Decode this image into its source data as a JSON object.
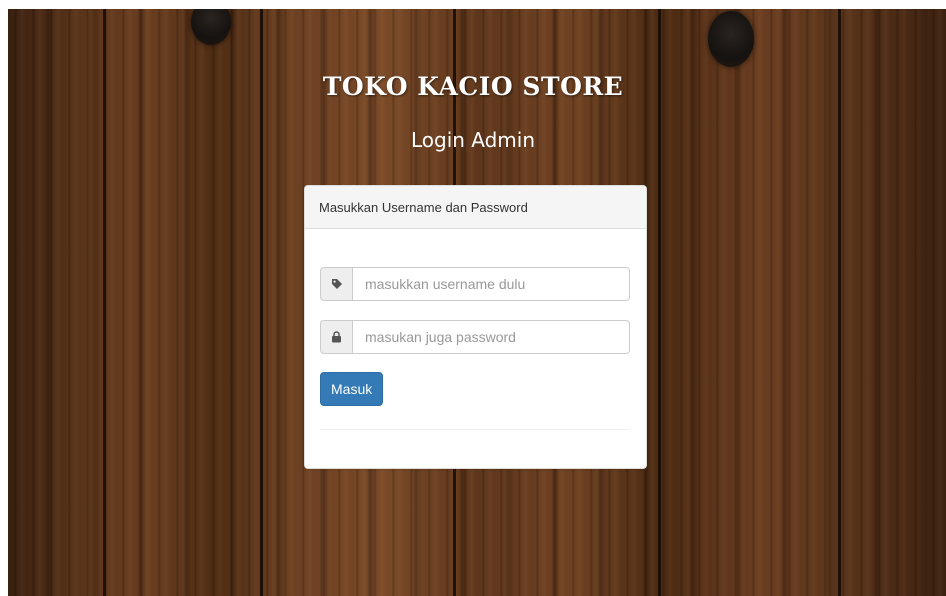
{
  "header": {
    "store_name": "TOKO KACIO STORE",
    "page_title": "Login Admin"
  },
  "login_panel": {
    "heading": "Masukkan Username dan Password",
    "username": {
      "placeholder": "masukkan username dulu",
      "value": "",
      "icon": "tag-icon"
    },
    "password": {
      "placeholder": "masukan juga password",
      "value": "",
      "icon": "lock-icon"
    },
    "submit_label": "Masuk"
  },
  "colors": {
    "primary_button": "#337ab7",
    "panel_heading_bg": "#f5f5f5",
    "background_wood": "#5a341a"
  }
}
